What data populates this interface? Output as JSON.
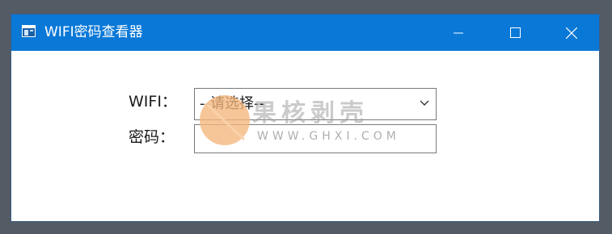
{
  "window": {
    "title": "WIFI密码查看器",
    "controls": {
      "minimize_icon": "minimize-icon",
      "maximize_icon": "maximize-icon",
      "close_icon": "close-icon"
    }
  },
  "form": {
    "wifi_label": "WIFI：",
    "wifi_select": {
      "selected": "--请选择--",
      "icon": "chevron-down-icon"
    },
    "password_label": "密码：",
    "password_value": ""
  },
  "watermark": {
    "text": "果核剥壳",
    "url": "WWW.GHXI.COM"
  },
  "colors": {
    "titlebar": "#0a78d7",
    "desktop": "#535b65",
    "watermark_circle": "#f3b67c"
  }
}
